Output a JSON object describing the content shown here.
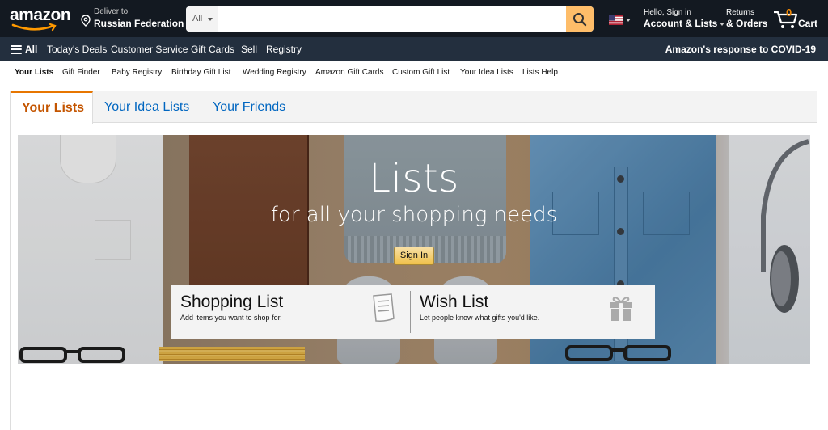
{
  "header": {
    "logo_text": "amazon",
    "deliver_line1": "Deliver to",
    "deliver_line2": "Russian Federation",
    "search_category": "All",
    "search_placeholder": "",
    "account_line1": "Hello, Sign in",
    "account_line2": "Account & Lists",
    "returns_line1": "Returns",
    "returns_line2": "& Orders",
    "cart_count": "0",
    "cart_label": "Cart",
    "colors": {
      "bg": "#131921",
      "search_button": "#febd69",
      "cart_count": "#f08804"
    }
  },
  "main_nav": {
    "all_label": "All",
    "items": [
      "Today's Deals",
      "Customer Service",
      "Gift Cards",
      "Sell",
      "Registry"
    ],
    "promo": "Amazon's response to COVID-19",
    "bg": "#232f3e"
  },
  "sub_nav": {
    "items": [
      "Your Lists",
      "Gift Finder",
      "Baby Registry",
      "Birthday Gift List",
      "Wedding Registry",
      "Amazon Gift Cards",
      "Custom Gift List",
      "Your Idea Lists",
      "Lists Help"
    ],
    "active": "Your Lists"
  },
  "tabs": {
    "items": [
      "Your Lists",
      "Your Idea Lists",
      "Your Friends"
    ],
    "active": "Your Lists",
    "active_color": "#c45500",
    "link_color": "#0066c0"
  },
  "hero": {
    "title": "Lists",
    "subtitle": "for all your shopping needs",
    "signin_label": "Sign In",
    "cards": [
      {
        "title": "Shopping List",
        "desc": "Add items you want to shop for.",
        "icon": "notepad-icon"
      },
      {
        "title": "Wish List",
        "desc": "Let people know what gifts you'd like.",
        "icon": "gift-icon"
      }
    ]
  }
}
